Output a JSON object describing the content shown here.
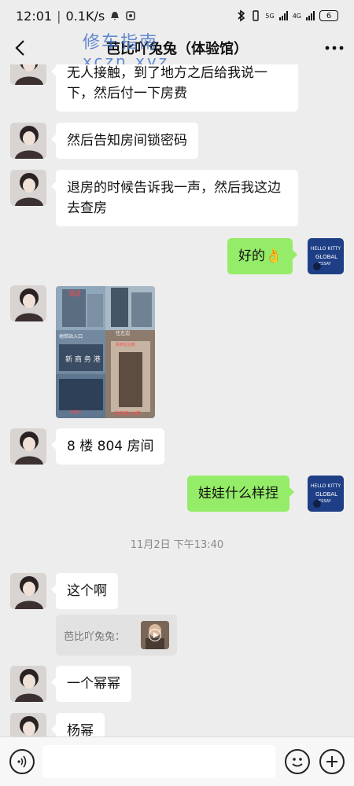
{
  "status_bar": {
    "time": "12:01",
    "net_speed": "0.1K/s",
    "sim1": "5G",
    "sim2": "4G",
    "battery": "6"
  },
  "nav": {
    "title": "芭比吖兔兔（体验馆）",
    "more_icon": "more-icon",
    "back_icon": "back-arrow-icon"
  },
  "watermark": {
    "line1": "修车指南",
    "line2": "xczn.xyz"
  },
  "messages": [
    {
      "side": "left",
      "text": "无人接触，到了地方之后给我说一下，然后付一下房费"
    },
    {
      "side": "left",
      "text": "然后告知房间锁密码"
    },
    {
      "side": "left",
      "text": "退房的时候告诉我一声，然后我这边去查房"
    },
    {
      "side": "right",
      "text": "好的👌"
    },
    {
      "side": "left",
      "type": "image"
    },
    {
      "side": "left",
      "text": "8 楼 804 房间"
    },
    {
      "side": "right",
      "text": "娃娃什么样捏"
    },
    {
      "side": "left",
      "text": "这个啊"
    },
    {
      "side": "left",
      "text": "一个幂幂"
    },
    {
      "side": "left",
      "text": "杨幂"
    }
  ],
  "photo_labels": {
    "top": "酒店",
    "label1": "地铁站入口",
    "label2": "往左边",
    "label3": "看到左边有",
    "label4": "电梯口",
    "label5": "进电梯上8楼",
    "sign": "新 商 务 港"
  },
  "right_avatar_text": {
    "line1": "HELLO KITTY",
    "line2": "GLOBAL",
    "line3": "ESSAY"
  },
  "timestamp": "11月2日 下午13:40",
  "quote": {
    "sender": "芭比吖兔兔："
  },
  "input": {
    "placeholder": ""
  },
  "colors": {
    "background": "#ededed",
    "bubble_self": "#95ec69",
    "bubble_other": "#ffffff"
  }
}
